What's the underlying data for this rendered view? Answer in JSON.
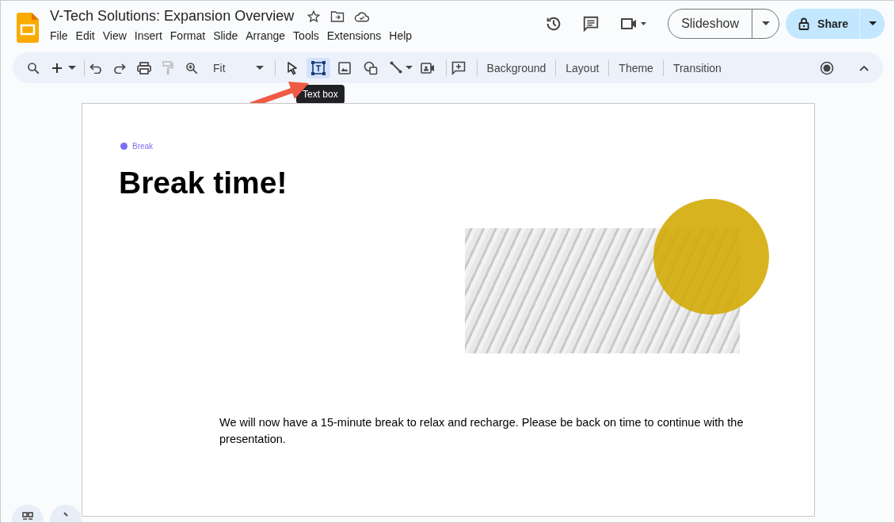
{
  "document": {
    "title": "V-Tech Solutions: Expansion Overview"
  },
  "menu": [
    "File",
    "Edit",
    "View",
    "Insert",
    "Format",
    "Slide",
    "Arrange",
    "Tools",
    "Extensions",
    "Help"
  ],
  "header_buttons": {
    "slideshow": "Slideshow",
    "share": "Share"
  },
  "toolbar": {
    "zoom": "Fit",
    "tools": [
      {
        "kind": "pointer",
        "selected": false
      },
      {
        "kind": "textbox",
        "selected": true
      },
      {
        "kind": "image",
        "selected": false
      },
      {
        "kind": "shape",
        "selected": false
      },
      {
        "kind": "line",
        "selected": false
      }
    ],
    "actions": [
      "Background",
      "Layout",
      "Theme",
      "Transition"
    ],
    "tooltip": "Text box"
  },
  "slide": {
    "tag": "Break",
    "heading": "Break time!",
    "body": "We will now have a 15-minute break to relax and recharge. Please be back on time to continue with the presentation."
  }
}
